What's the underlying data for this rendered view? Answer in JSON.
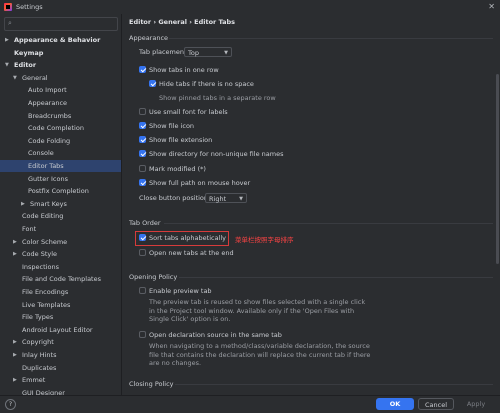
{
  "window": {
    "title": "Settings"
  },
  "sidebar": {
    "items": [
      {
        "label": "Appearance & Behavior",
        "bold": true,
        "expandable": true,
        "expanded": false
      },
      {
        "label": "Keymap",
        "bold": true
      },
      {
        "label": "Editor",
        "bold": true,
        "expandable": true,
        "expanded": true
      },
      {
        "label": "General",
        "expandable": true,
        "expanded": true
      },
      {
        "label": "Auto Import"
      },
      {
        "label": "Appearance"
      },
      {
        "label": "Breadcrumbs"
      },
      {
        "label": "Code Completion"
      },
      {
        "label": "Code Folding"
      },
      {
        "label": "Console"
      },
      {
        "label": "Editor Tabs",
        "selected": true
      },
      {
        "label": "Gutter Icons"
      },
      {
        "label": "Postfix Completion"
      },
      {
        "label": "Smart Keys",
        "expandable": true,
        "expanded": false
      },
      {
        "label": "Code Editing"
      },
      {
        "label": "Font"
      },
      {
        "label": "Color Scheme",
        "expandable": true,
        "expanded": false
      },
      {
        "label": "Code Style",
        "expandable": true,
        "expanded": false
      },
      {
        "label": "Inspections"
      },
      {
        "label": "File and Code Templates"
      },
      {
        "label": "File Encodings"
      },
      {
        "label": "Live Templates"
      },
      {
        "label": "File Types"
      },
      {
        "label": "Android Layout Editor"
      },
      {
        "label": "Copyright",
        "expandable": true,
        "expanded": false
      },
      {
        "label": "Inlay Hints",
        "expandable": true,
        "expanded": false
      },
      {
        "label": "Duplicates"
      },
      {
        "label": "Emmet",
        "expandable": true,
        "expanded": false
      },
      {
        "label": "GUI Designer"
      }
    ]
  },
  "breadcrumb": {
    "parts": [
      "Editor",
      "General",
      "Editor Tabs"
    ],
    "separator": "›"
  },
  "appearance": {
    "title": "Appearance",
    "tab_placement_label": "Tab placement:",
    "tab_placement_value": "Top",
    "show_tabs_one_row": "Show tabs in one row",
    "hide_tabs_no_space": "Hide tabs if there is no space",
    "show_pinned_separate_row": "Show pinned tabs in a separate row",
    "use_small_font": "Use small font for labels",
    "show_file_icon": "Show file icon",
    "show_file_extension": "Show file extension",
    "show_directory": "Show directory for non-unique file names",
    "mark_modified": "Mark modified (*)",
    "show_full_path": "Show full path on mouse hover",
    "close_button_label": "Close button position:",
    "close_button_value": "Right"
  },
  "tab_order": {
    "title": "Tab Order",
    "sort_alphabetically": "Sort tabs alphabetically",
    "open_new_at_end": "Open new tabs at the end",
    "annotation": "菜单栏按照字母排序"
  },
  "opening_policy": {
    "title": "Opening Policy",
    "enable_preview": "Enable preview tab",
    "enable_preview_desc": [
      "The preview tab is reused to show files selected with a single click",
      "in the Project tool window. Available only if the 'Open Files with",
      "Single Click' option is on."
    ],
    "open_declaration": "Open declaration source in the same tab",
    "open_declaration_desc": [
      "When navigating to a method/class/variable declaration, the source",
      "file that contains the declaration will replace the current tab if there",
      "are no changes."
    ]
  },
  "closing_policy": {
    "title": "Closing Policy"
  },
  "footer": {
    "help": "?",
    "ok": "OK",
    "cancel": "Cancel",
    "apply": "Apply"
  },
  "colors": {
    "accent": "#3574f0",
    "selection": "#2e436e",
    "annotation_red": "#ff4444"
  }
}
